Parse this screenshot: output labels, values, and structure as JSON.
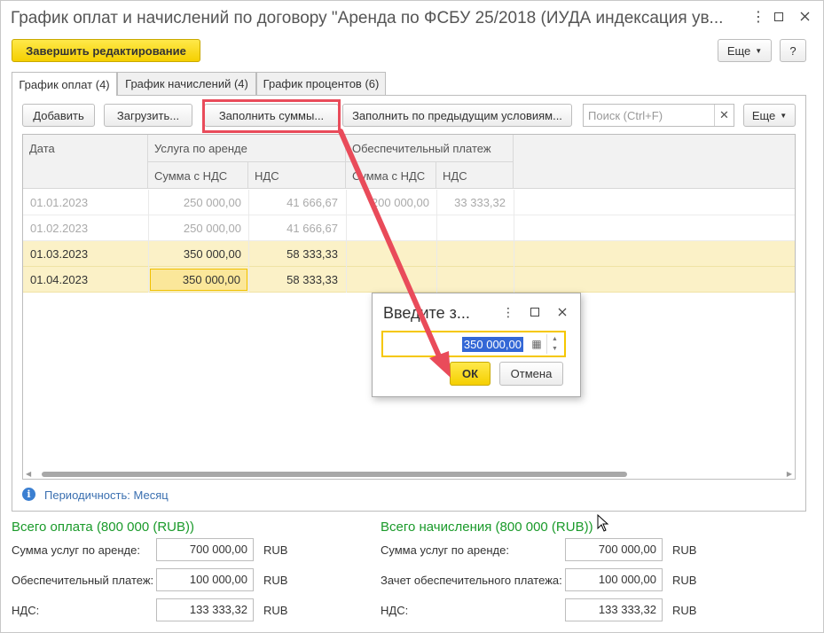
{
  "window": {
    "title": "График оплат и начислений по договору \"Аренда по ФСБУ 25/2018 (ИУДА индексация ув..."
  },
  "toolbar": {
    "finish_label": "Завершить редактирование",
    "more_label": "Еще",
    "help_label": "?"
  },
  "tabs": [
    {
      "label": "График оплат (4)",
      "active": true
    },
    {
      "label": "График начислений (4)",
      "active": false
    },
    {
      "label": "График процентов (6)",
      "active": false
    }
  ],
  "panel_toolbar": {
    "add_label": "Добавить",
    "load_label": "Загрузить...",
    "fill_sums_label": "Заполнить суммы...",
    "fill_prev_label": "Заполнить по предыдущим условиям...",
    "search_placeholder": "Поиск (Ctrl+F)",
    "more_label": "Еще"
  },
  "table": {
    "headers": {
      "date": "Дата",
      "group_rent": "Услуга по аренде",
      "group_deposit": "Обеспечительный платеж",
      "sum_vat": "Сумма с НДС",
      "vat": "НДС",
      "sum_vat2": "Сумма с НДС",
      "vat2": "НДС"
    },
    "rows": [
      {
        "date": "01.01.2023",
        "rent_sum": "250 000,00",
        "rent_vat": "41 666,67",
        "dep_sum": "200 000,00",
        "dep_vat": "33 333,32",
        "muted": true,
        "highlight": false
      },
      {
        "date": "01.02.2023",
        "rent_sum": "250 000,00",
        "rent_vat": "41 666,67",
        "dep_sum": "",
        "dep_vat": "",
        "muted": true,
        "highlight": false
      },
      {
        "date": "01.03.2023",
        "rent_sum": "350 000,00",
        "rent_vat": "58 333,33",
        "dep_sum": "",
        "dep_vat": "",
        "muted": false,
        "highlight": true
      },
      {
        "date": "01.04.2023",
        "rent_sum": "350 000,00",
        "rent_vat": "58 333,33",
        "dep_sum": "",
        "dep_vat": "",
        "muted": false,
        "highlight": true
      }
    ]
  },
  "info": {
    "text": "Периодичность: Месяц"
  },
  "totals_pay": {
    "title": "Всего оплата (800 000 (RUB))",
    "rows": [
      {
        "label": "Сумма услуг по аренде:",
        "value": "700 000,00",
        "currency": "RUB"
      },
      {
        "label": "Обеспечительный платеж:",
        "value": "100 000,00",
        "currency": "RUB"
      },
      {
        "label": "НДС:",
        "value": "133 333,32",
        "currency": "RUB"
      }
    ]
  },
  "totals_accr": {
    "title": "Всего начисления (800 000 (RUB))",
    "rows": [
      {
        "label": "Сумма услуг по аренде:",
        "value": "700 000,00",
        "currency": "RUB"
      },
      {
        "label": "Зачет обеспечительного платежа:",
        "value": "100 000,00",
        "currency": "RUB"
      },
      {
        "label": "НДС:",
        "value": "133 333,32",
        "currency": "RUB"
      }
    ]
  },
  "dialog": {
    "title": "Введите з...",
    "value": "350 000,00",
    "ok_label": "ОК",
    "cancel_label": "Отмена"
  },
  "colors": {
    "accent_yellow": "#f5cf00",
    "highlight_row": "#fbf1c7",
    "total_green": "#1a9a2a",
    "annotation_red": "#e94b5a",
    "selection_blue": "#3367d6"
  }
}
